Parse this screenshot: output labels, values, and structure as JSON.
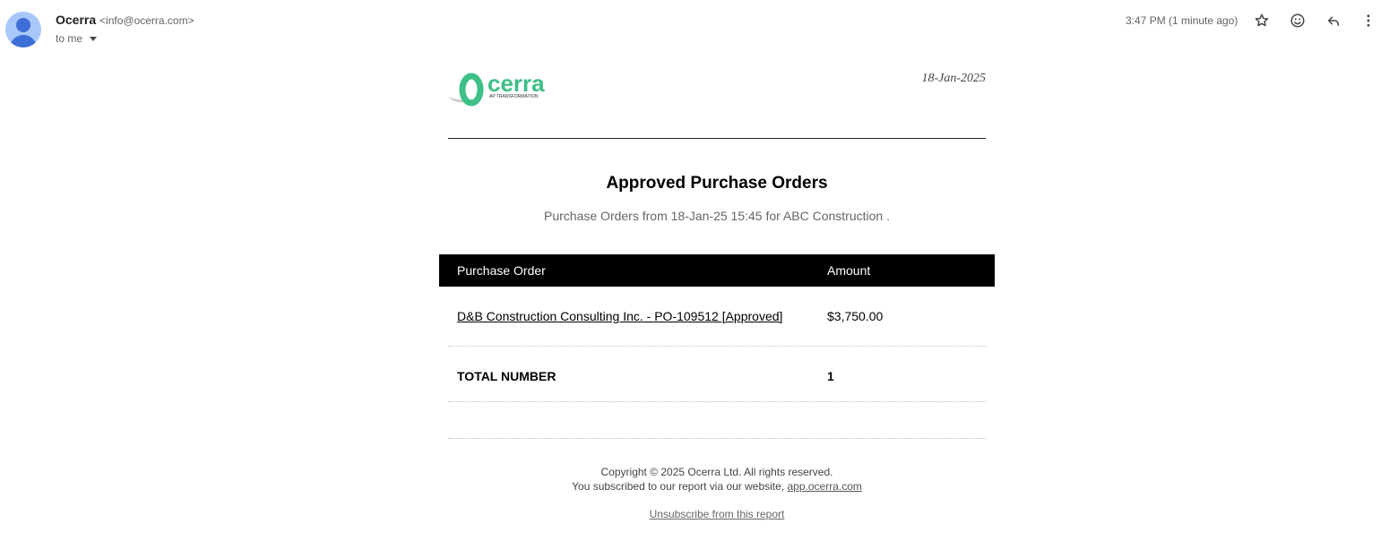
{
  "email_header": {
    "sender_name": "Ocerra",
    "sender_email": "<info@ocerra.com>",
    "recipient": "to me",
    "timestamp": "3:47 PM (1 minute ago)",
    "icons": [
      "star-icon",
      "emoji-icon",
      "reply-icon",
      "more-vert-icon"
    ]
  },
  "email_body": {
    "logo": {
      "text": "cerra",
      "tagline": "AP TRANSFORMATION",
      "brand_color": "#3dbf86"
    },
    "date": "18-Jan-2025",
    "title": "Approved Purchase Orders",
    "subtitle": "Purchase Orders from 18-Jan-25 15:45 for ABC Construction .",
    "table": {
      "headers": [
        "Purchase Order",
        "Amount"
      ],
      "rows": [
        {
          "purchase_order": "D&B Construction Consulting Inc. - PO-109512 [Approved]",
          "amount": "$3,750.00"
        }
      ],
      "total_label": "TOTAL NUMBER",
      "total_value": "1"
    },
    "footer": {
      "copyright": "Copyright © 2025 Ocerra Ltd. All rights reserved.",
      "subscribed_text": "You subscribed to our report via our website,",
      "website_link": "app.ocerra.com",
      "unsubscribe": "Unsubscribe from this report"
    }
  }
}
